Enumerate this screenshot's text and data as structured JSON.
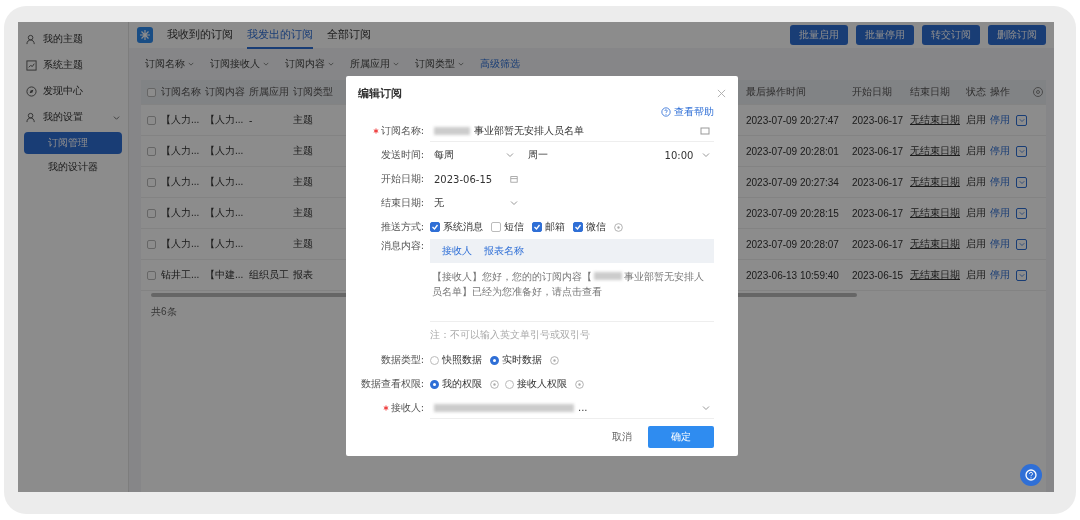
{
  "sidebar": {
    "items": [
      {
        "label": "我的主题"
      },
      {
        "label": "系统主题"
      },
      {
        "label": "发现中心"
      },
      {
        "label": "我的设置",
        "expanded": true,
        "children": [
          {
            "label": "订阅管理",
            "selected": true
          },
          {
            "label": "我的设计器",
            "selected": false
          }
        ]
      }
    ]
  },
  "tabs": [
    {
      "label": "我收到的订阅",
      "selected": false
    },
    {
      "label": "我发出的订阅",
      "selected": true
    },
    {
      "label": "全部订阅",
      "selected": false
    }
  ],
  "toolbar_buttons": [
    "批量启用",
    "批量停用",
    "转交订阅",
    "删除订阅"
  ],
  "filters": [
    "订阅名称",
    "订阅接收人",
    "订阅内容",
    "所属应用",
    "订阅类型"
  ],
  "advanced_filter": "高级筛选",
  "table": {
    "select_all_checked": false,
    "left_columns": [
      "订阅名称",
      "订阅内容",
      "所属应用",
      "订阅类型"
    ],
    "right_columns": [
      "最后操作时间",
      "开始日期",
      "结束日期",
      "状态",
      "操作"
    ],
    "rows": [
      {
        "checked": false,
        "name": "【人力...",
        "content": "【人力...",
        "app": "-",
        "type": "主题",
        "last_operated": "2023-07-09 20:27:47",
        "start": "2023-06-17",
        "end": "无结束日期",
        "status": "启用",
        "action": "停用"
      },
      {
        "checked": false,
        "name": "【人力...",
        "content": "【人力...",
        "type": "主题",
        "last_operated": "2023-07-09 20:28:01",
        "start": "2023-06-17",
        "end": "无结束日期",
        "status": "启用",
        "action": "停用"
      },
      {
        "checked": false,
        "name": "【人力...",
        "content": "【人力...",
        "type": "主题",
        "last_operated": "2023-07-09 20:27:34",
        "start": "2023-06-17",
        "end": "无结束日期",
        "status": "启用",
        "action": "停用"
      },
      {
        "checked": false,
        "name": "【人力...",
        "content": "【人力...",
        "type": "主题",
        "last_operated": "2023-07-09 20:28:15",
        "start": "2023-06-17",
        "end": "无结束日期",
        "status": "启用",
        "action": "停用"
      },
      {
        "checked": false,
        "name": "【人力...",
        "content": "【人力...",
        "type": "主题",
        "last_operated": "2023-07-09 20:28:07",
        "start": "2023-06-17",
        "end": "无结束日期",
        "status": "启用",
        "action": "停用"
      },
      {
        "checked": false,
        "name": "钻井工...",
        "content": "【中建...",
        "app": "组织员工",
        "type": "报表",
        "last_operated": "2023-06-13 10:59:40",
        "start": "2023-06-15",
        "end": "无结束日期",
        "status": "启用",
        "action": "停用"
      }
    ],
    "total": "共6条"
  },
  "dialog": {
    "title": "编辑订阅",
    "help_link": "查看帮助",
    "name": {
      "label": "订阅名称:",
      "required": true,
      "value": "事业部暂无安排人员名单"
    },
    "send_time": {
      "label": "发送时间:",
      "frequency": "每周",
      "day": "周一",
      "time": "10:00"
    },
    "start_date": {
      "label": "开始日期:",
      "value": "2023-06-15"
    },
    "end_date": {
      "label": "结束日期:",
      "value": "无"
    },
    "push": {
      "label": "推送方式:",
      "options": [
        {
          "label": "系统消息",
          "checked": true
        },
        {
          "label": "短信",
          "checked": false
        },
        {
          "label": "邮箱",
          "checked": true
        },
        {
          "label": "微信",
          "checked": true
        }
      ]
    },
    "message": {
      "label": "消息内容:",
      "tags": [
        "接收人",
        "报表名称"
      ],
      "text_before": "【接收人】您好，您的的订阅内容【",
      "text_after": "事业部暂无安排人员名单】已经为您准备好，请点击查看"
    },
    "note": "注：不可以输入英文单引号或双引号",
    "data_type": {
      "label": "数据类型:",
      "options": [
        {
          "label": "快照数据",
          "selected": false
        },
        {
          "label": "实时数据",
          "selected": true
        }
      ]
    },
    "permission": {
      "label": "数据查看权限:",
      "options": [
        {
          "label": "我的权限",
          "selected": true
        },
        {
          "label": "接收人权限",
          "selected": false
        }
      ]
    },
    "receiver": {
      "label": "接收人:",
      "required": true,
      "suffix": "..."
    },
    "cancel": "取消",
    "confirm": "确定"
  }
}
